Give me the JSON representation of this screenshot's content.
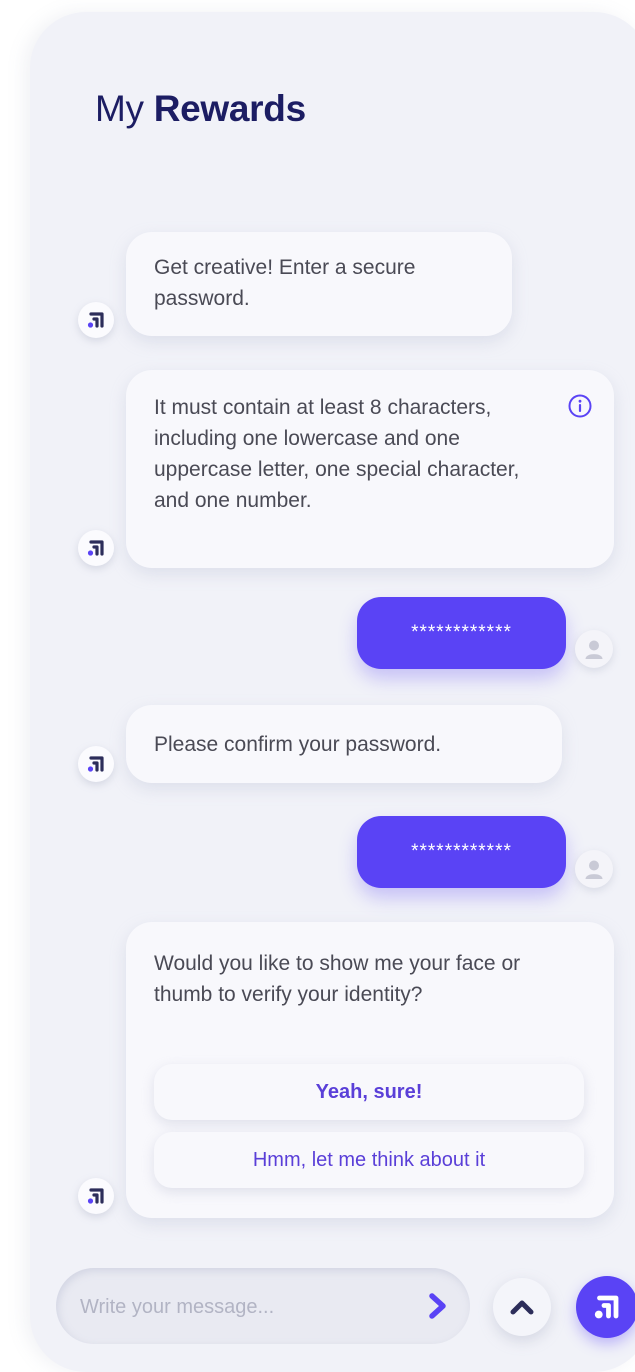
{
  "header": {
    "title_prefix": "My",
    "title_bold": "Rewards"
  },
  "messages": {
    "bot1": "Get creative! Enter a secure password.",
    "bot2": "It must contain at least 8 characters, including one lowercase and one uppercase letter, one special character, and one number.",
    "user1": "************",
    "bot3": "Please confirm your password.",
    "user2": "************",
    "bot4": "Would you like to show me your face or thumb to verify your identity?"
  },
  "options": {
    "yes": "Yeah, sure!",
    "think": "Hmm, let me think about it"
  },
  "composer": {
    "placeholder": "Write your message..."
  },
  "icons": {
    "bot_avatar": "brand-logo-icon",
    "user_avatar": "user-icon",
    "info": "info-icon",
    "send": "chevron-right-icon",
    "scroll": "chevron-up-icon",
    "brand": "brand-logo-icon"
  },
  "colors": {
    "accent": "#5a43f5",
    "title": "#1c1d63",
    "background": "#f1f2f8",
    "bubble": "#f8f8fc"
  }
}
